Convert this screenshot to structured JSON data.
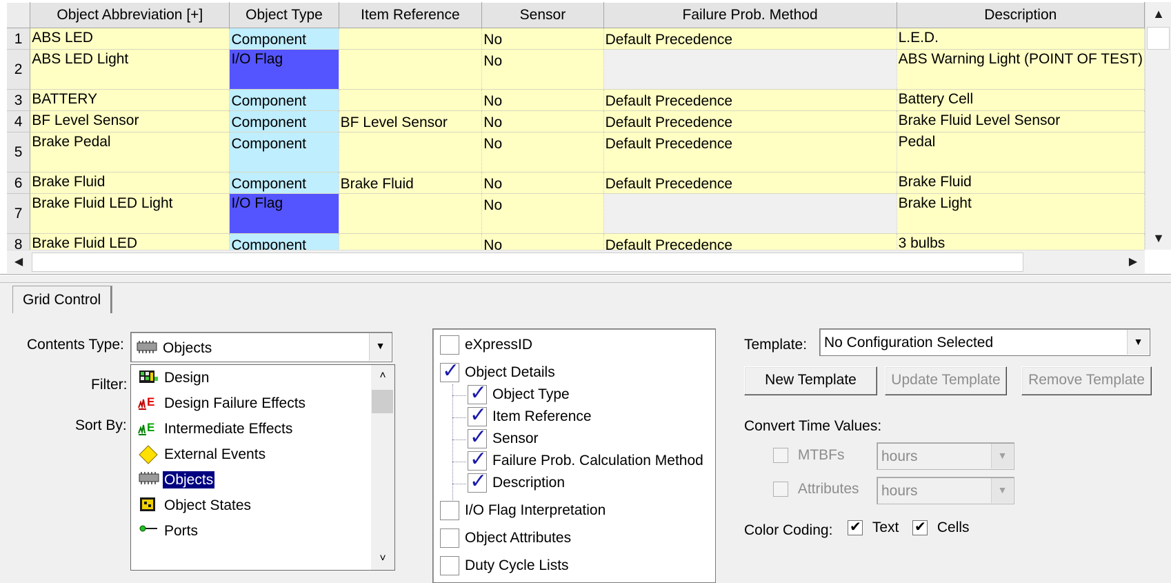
{
  "grid": {
    "columns": [
      "Object Abbreviation [+]",
      "Object Type",
      "Item Reference",
      "Sensor",
      "Failure Prob. Method",
      "Description"
    ],
    "rows": [
      {
        "num": "1",
        "abbr": "ABS LED",
        "type": "Component",
        "type_kind": "comp",
        "ref": "",
        "sensor": "No",
        "method": "Default Precedence",
        "desc": "L.E.D."
      },
      {
        "num": "2",
        "abbr": "ABS LED Light",
        "type": "I/O Flag",
        "type_kind": "io",
        "ref": "",
        "sensor": "No",
        "method": "",
        "desc": "ABS Warning Light\n(POINT OF TEST)"
      },
      {
        "num": "3",
        "abbr": "BATTERY",
        "type": "Component",
        "type_kind": "comp",
        "ref": "",
        "sensor": "No",
        "method": "Default Precedence",
        "desc": "Battery Cell"
      },
      {
        "num": "4",
        "abbr": "BF Level Sensor",
        "type": "Component",
        "type_kind": "comp",
        "ref": "BF Level Sensor",
        "sensor": "No",
        "method": "Default Precedence",
        "desc": "Brake Fluid Level Sensor"
      },
      {
        "num": "5",
        "abbr": "Brake\nPedal",
        "type": "Component",
        "type_kind": "comp",
        "ref": "",
        "sensor": "No",
        "method": "Default Precedence",
        "desc": "Pedal"
      },
      {
        "num": "6",
        "abbr": "Brake Fluid",
        "type": "Component",
        "type_kind": "comp",
        "ref": "Brake Fluid",
        "sensor": "No",
        "method": "Default Precedence",
        "desc": "Brake Fluid"
      },
      {
        "num": "7",
        "abbr": "Brake Fluid\nLED Light",
        "type": "I/O Flag",
        "type_kind": "io",
        "ref": "",
        "sensor": "No",
        "method": "",
        "desc": "Brake Light"
      },
      {
        "num": "8",
        "abbr": "Brake Fluid LED",
        "type": "Component",
        "type_kind": "comp",
        "ref": "",
        "sensor": "No",
        "method": "Default Precedence",
        "desc": "3 bulbs"
      }
    ]
  },
  "tab": {
    "label": "Grid Control"
  },
  "contents": {
    "label": "Contents Type:",
    "value": "Objects",
    "filter_label": "Filter:",
    "sort_label": "Sort By:",
    "options": [
      {
        "label": "Design",
        "icon": "design-icon"
      },
      {
        "label": "Design Failure Effects",
        "icon": "design-failure-effects-icon"
      },
      {
        "label": "Intermediate Effects",
        "icon": "intermediate-effects-icon"
      },
      {
        "label": "External Events",
        "icon": "external-events-icon"
      },
      {
        "label": "Objects",
        "icon": "objects-icon",
        "selected": true
      },
      {
        "label": "Object States",
        "icon": "object-states-icon"
      },
      {
        "label": "Ports",
        "icon": "ports-icon"
      }
    ]
  },
  "tree": {
    "items": [
      {
        "label": "eXpressID",
        "checked": false,
        "level": 0
      },
      {
        "label": "Object Details",
        "checked": true,
        "level": 0
      },
      {
        "label": "Object Type",
        "checked": true,
        "level": 1
      },
      {
        "label": "Item Reference",
        "checked": true,
        "level": 1
      },
      {
        "label": "Sensor",
        "checked": true,
        "level": 1
      },
      {
        "label": "Failure Prob. Calculation Method",
        "checked": true,
        "level": 1
      },
      {
        "label": "Description",
        "checked": true,
        "level": 1
      },
      {
        "label": "I/O Flag Interpretation",
        "checked": false,
        "level": 0
      },
      {
        "label": "Object Attributes",
        "checked": false,
        "level": 0
      },
      {
        "label": "Duty Cycle Lists",
        "checked": false,
        "level": 0
      }
    ]
  },
  "template": {
    "label": "Template:",
    "value": "No Configuration Selected",
    "new_label": "New Template",
    "update_label": "Update Template",
    "remove_label": "Remove Template"
  },
  "convert": {
    "title": "Convert Time Values:",
    "mtbf_label": "MTBFs",
    "mtbf_unit": "hours",
    "attr_label": "Attributes",
    "attr_unit": "hours"
  },
  "color_coding": {
    "label": "Color Coding:",
    "text_label": "Text",
    "text_checked": true,
    "cells_label": "Cells",
    "cells_checked": true
  },
  "colors": {
    "row_bg": "#ffffc4",
    "component_bg": "#bfeeff",
    "io_flag_bg": "#5555ff",
    "selection": "#000080"
  }
}
